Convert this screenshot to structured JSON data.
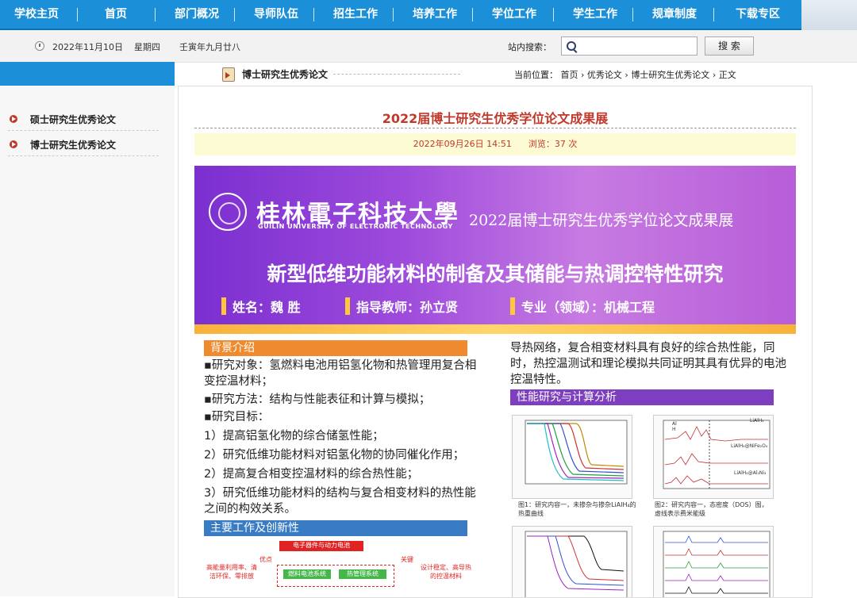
{
  "nav": {
    "items": [
      "学校主页",
      "首页",
      "部门概况",
      "导师队伍",
      "招生工作",
      "培养工作",
      "学位工作",
      "学生工作",
      "规章制度",
      "下载专区"
    ]
  },
  "datebar": {
    "date": "2022年11月10日",
    "weekday": "星期四",
    "lunar": "壬寅年九月廿八",
    "search_label": "站内搜索：",
    "search_value": "",
    "search_button": "搜 索"
  },
  "sidebar": {
    "items": [
      {
        "label": "硕士研究生优秀论文",
        "icon": "arrow-bullet-icon"
      },
      {
        "label": "博士研究生优秀论文",
        "icon": "arrow-bullet-icon"
      }
    ]
  },
  "crumb": {
    "section_title": "博士研究生优秀论文",
    "location_label": "当前位置：",
    "path": [
      "首页",
      "优秀论文",
      "博士研究生优秀论文",
      "正文"
    ],
    "sep": "›"
  },
  "article": {
    "title": "2022届博士研究生优秀学位论文成果展",
    "date": "2022年09月26日 14:51",
    "views_label": "浏览：",
    "views": "37",
    "views_unit": "次"
  },
  "poster": {
    "university_cn": "桂林電子科技大學",
    "university_en": "GUILIN UNIVERSITY OF ELECTRONIC TECHNOLOGY",
    "expo": "2022届博士研究生优秀学位论文成果展",
    "thesis_title": "新型低维功能材料的制备及其储能与热调控特性研究",
    "name": "姓名：魏 胜",
    "advisor": "指导教师：孙立贤",
    "major": "专业（领域）：机械工程",
    "bg_head": "背景介绍",
    "bg_lines": [
      "▪研究对象：氢燃料电池用铝氢化物和热管理用复合相变控温材料；",
      "▪研究方法：结构与性能表征和计算与模拟；",
      "▪研究目标：",
      "1）提高铝氢化物的综合储氢性能；",
      "2）研究低维功能材料对铝氢化物的协同催化作用；",
      "2）提高复合相变控温材料的综合热性能；",
      "3）研究低维功能材料的结构与复合相变材料的热性能之间的构效关系。"
    ],
    "main_head": "主要工作及创新性",
    "flow_top": "电子器件与动力电池",
    "flow_l1": "优点",
    "flow_l2": "高能量利用率、清洁环保、零排放",
    "flow_r1": "关键",
    "flow_r2": "设计稳定、高导热的控温材料",
    "flow_b1": "燃料电池系统",
    "flow_b2": "热管理系统",
    "right_lines": "导热网络，复合相变材料具有良好的综合热性能，同时，热控温测试和理论模拟共同证明其具有优异的电池控温特性。",
    "perf_head": "性能研究与计算分析",
    "cap1": "图1：研究内容一，未掺杂与掺杂LiAlH₄的热重曲线",
    "cap2": "图2：研究内容一，态密度（DOS）图，虚线表示费米能级",
    "fig2_labels": [
      "LiAlH₄",
      "LiAlH₄@NiFe₂O₄",
      "LiAlH₄@Al₂Ni₃"
    ],
    "fig2_legend": [
      "Al",
      "H"
    ]
  },
  "colors": {
    "nav_bg": "#1b8fd8",
    "title_red": "#c0392b",
    "banner_purple": "#8e3fd6",
    "bg_head_orange": "#f08a2e",
    "main_head_blue": "#3a7cc4",
    "perf_head_purple": "#7d3fbf"
  }
}
